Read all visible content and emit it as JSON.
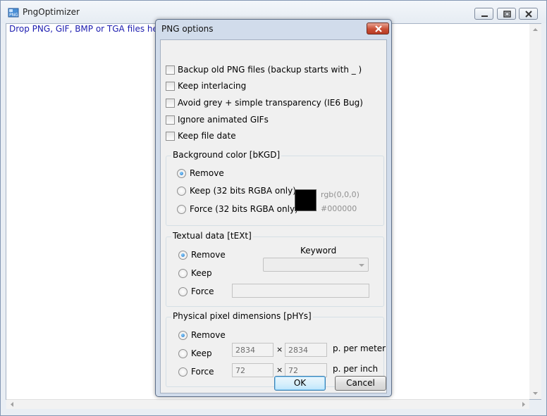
{
  "window": {
    "title": "PngOptimizer",
    "drop_hint": "Drop PNG, GIF, BMP or TGA files here"
  },
  "dialog": {
    "title": "PNG options",
    "checkboxes": [
      {
        "label": "Backup old PNG files (backup starts with _ )",
        "checked": false
      },
      {
        "label": "Keep interlacing",
        "checked": false
      },
      {
        "label": "Avoid grey + simple transparency (IE6 Bug)",
        "checked": false
      },
      {
        "label": "Ignore animated GIFs",
        "checked": false
      },
      {
        "label": "Keep file date",
        "checked": false
      }
    ],
    "background": {
      "title": "Background color [bKGD]",
      "options": [
        "Remove",
        "Keep (32 bits RGBA only)",
        "Force (32 bits RGBA only)"
      ],
      "selected": 0,
      "swatch_color": "#000000",
      "rgb_text": "rgb(0,0,0)",
      "hex_text": "#000000"
    },
    "textual": {
      "title": "Textual data [tEXt]",
      "options": [
        "Remove",
        "Keep",
        "Force"
      ],
      "selected": 0,
      "keyword_label": "Keyword",
      "keyword_value": "",
      "text_value": ""
    },
    "physical": {
      "title": "Physical pixel dimensions [pHYs]",
      "options": [
        "Remove",
        "Keep",
        "Force"
      ],
      "selected": 0,
      "keep_x": "2834",
      "keep_y": "2834",
      "keep_unit": "p. per meter",
      "force_x": "72",
      "force_y": "72",
      "force_unit": "p. per inch",
      "times": "×"
    },
    "ok_label": "OK",
    "cancel_label": "Cancel"
  },
  "colors": {
    "link_blue": "#1c1cb0",
    "accent_radio": "#1a6fc4"
  }
}
